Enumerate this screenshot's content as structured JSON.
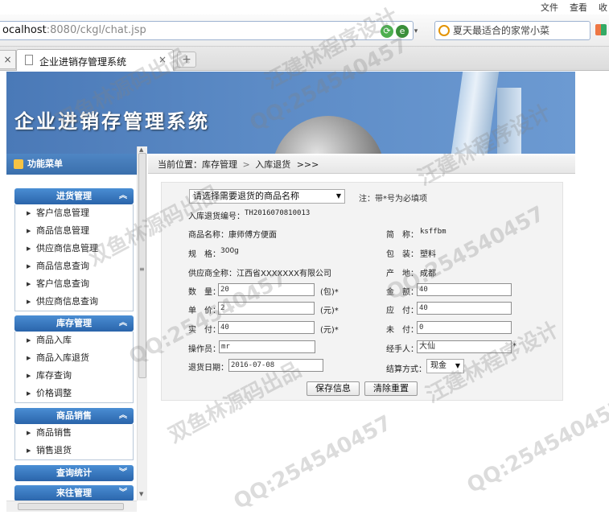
{
  "browser": {
    "menubar": [
      "文件",
      "查看",
      "收"
    ],
    "url_host": "ocalhost",
    "url_path": ":8080/ckgl/chat.jsp",
    "search_text": "夏天最适合的家常小菜",
    "tab_title": "企业进销存管理系统",
    "tab_close_glyph": "×",
    "new_tab_glyph": "+"
  },
  "banner": {
    "title": "企业进销存管理系统"
  },
  "sidebar": {
    "header": "功能菜单",
    "groups": [
      {
        "label": "进货管理",
        "items": [
          "客户信息管理",
          "商品信息管理",
          "供应商信息管理",
          "商品信息查询",
          "客户信息查询",
          "供应商信息查询"
        ]
      },
      {
        "label": "库存管理",
        "items": [
          "商品入库",
          "商品入库退货",
          "库存查询",
          "价格调整"
        ]
      },
      {
        "label": "商品销售",
        "items": [
          "商品销售",
          "销售退货"
        ]
      },
      {
        "label": "查询统计",
        "items": []
      },
      {
        "label": "来往管理",
        "items": []
      }
    ]
  },
  "breadcrumb": {
    "prefix": "当前位置：",
    "level1": "库存管理",
    "sep": ">",
    "level2": "入库退货",
    "tail": ">>>"
  },
  "form": {
    "select_goods": "请选择需要退货的商品名称",
    "note": "注：带*号为必填项",
    "return_no_label": "入库退货编号：",
    "return_no": "TH2016070810013",
    "goods_name_label": "商品名称：",
    "goods_name": "康师傅方便面",
    "short_label": "简　称：",
    "short_value": "ksffbm",
    "spec_label": "规　格：",
    "spec_value": "300g",
    "package_label": "包　装：",
    "package_value": "塑料",
    "supplier_label": "供应商全称：",
    "supplier_value": "江西省XXXXXXX有限公司",
    "origin_label": "产　地：",
    "origin_value": "成都",
    "qty_label": "数　量：",
    "qty_value": "20",
    "qty_unit": "(包)*",
    "amount_label": "金　额：",
    "amount_value": "40",
    "price_label": "单　价：",
    "price_value": "2",
    "price_unit": "(元)*",
    "payable_label": "应　付：",
    "payable_value": "40",
    "paid_label": "实　付：",
    "paid_value": "40",
    "paid_unit": "(元)*",
    "unpaid_label": "未　付：",
    "unpaid_value": "0",
    "operator_label": "操作员：",
    "operator_value": "mr",
    "handler_label": "经手人：",
    "handler_value": "大仙",
    "handler_star": "*",
    "date_label": "退货日期：",
    "date_value": "2016-07-08",
    "settle_label": "结算方式：",
    "settle_value": "现金",
    "save_button": "保存信息",
    "reset_button": "清除重置"
  },
  "watermarks": [
    "汪建林程序设计",
    "双鱼林源码出品",
    "QQ:254540457"
  ]
}
